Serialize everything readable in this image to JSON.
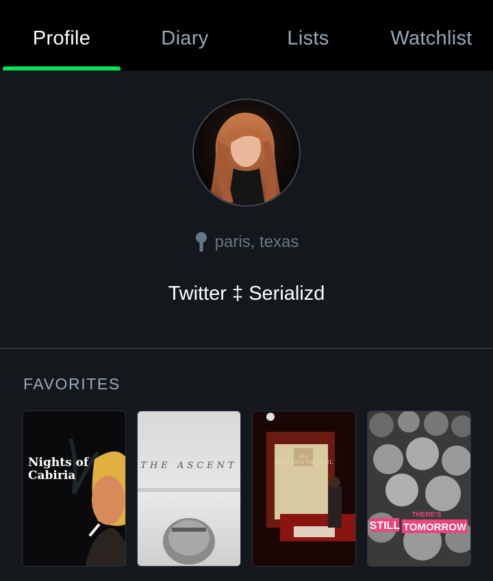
{
  "tabs": [
    {
      "label": "Profile",
      "active": true
    },
    {
      "label": "Diary",
      "active": false
    },
    {
      "label": "Lists",
      "active": false
    },
    {
      "label": "Watchlist",
      "active": false
    }
  ],
  "accent_color": "#00e054",
  "profile": {
    "avatar_icon": "user-avatar",
    "location_icon": "map-pin-icon",
    "location": "paris, texas",
    "bio": "Twitter ‡ Serializd"
  },
  "favorites": {
    "heading": "FAVORITES",
    "films": [
      {
        "poster_title": "Nights of Cabiria"
      },
      {
        "poster_title": "THE ASCENT"
      },
      {
        "poster_title_line1": "ALI:",
        "poster_title_line2": "FEAR EATS THE SOUL"
      },
      {
        "poster_title_line1": "THERE'S",
        "poster_title_line2": "STILL",
        "poster_title_line3": "TOMORROW"
      }
    ]
  }
}
